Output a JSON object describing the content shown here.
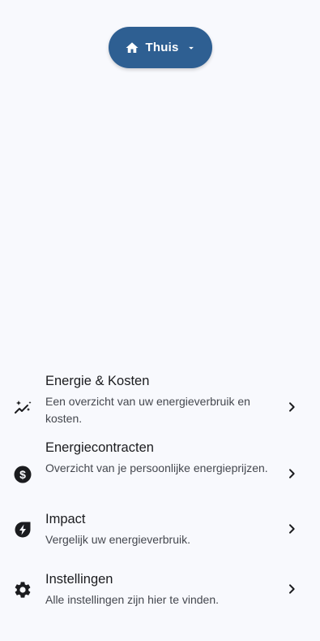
{
  "header": {
    "home_selector": {
      "label": "Thuis",
      "icon": "home-icon",
      "dropdown_icon": "caret-down-icon"
    }
  },
  "menu": {
    "items": [
      {
        "title": "Energie & Kosten",
        "subtitle": "Een overzicht van uw energieverbruik en kosten.",
        "icon": "sparkle-chart-icon"
      },
      {
        "title": "Energiecontracten",
        "subtitle": "Overzicht van je persoonlijke energieprijzen.",
        "icon": "dollar-circle-icon"
      },
      {
        "title": "Impact",
        "subtitle": "Vergelijk uw energieverbruik.",
        "icon": "eco-bolt-icon"
      },
      {
        "title": "Instellingen",
        "subtitle": "Alle instellingen zijn hier te vinden.",
        "icon": "gear-icon"
      }
    ]
  },
  "colors": {
    "background": "#f8f9fd",
    "selector_bg": "#2e5f92",
    "title_text": "#1b1c1f",
    "subtitle_text": "#44474e"
  }
}
